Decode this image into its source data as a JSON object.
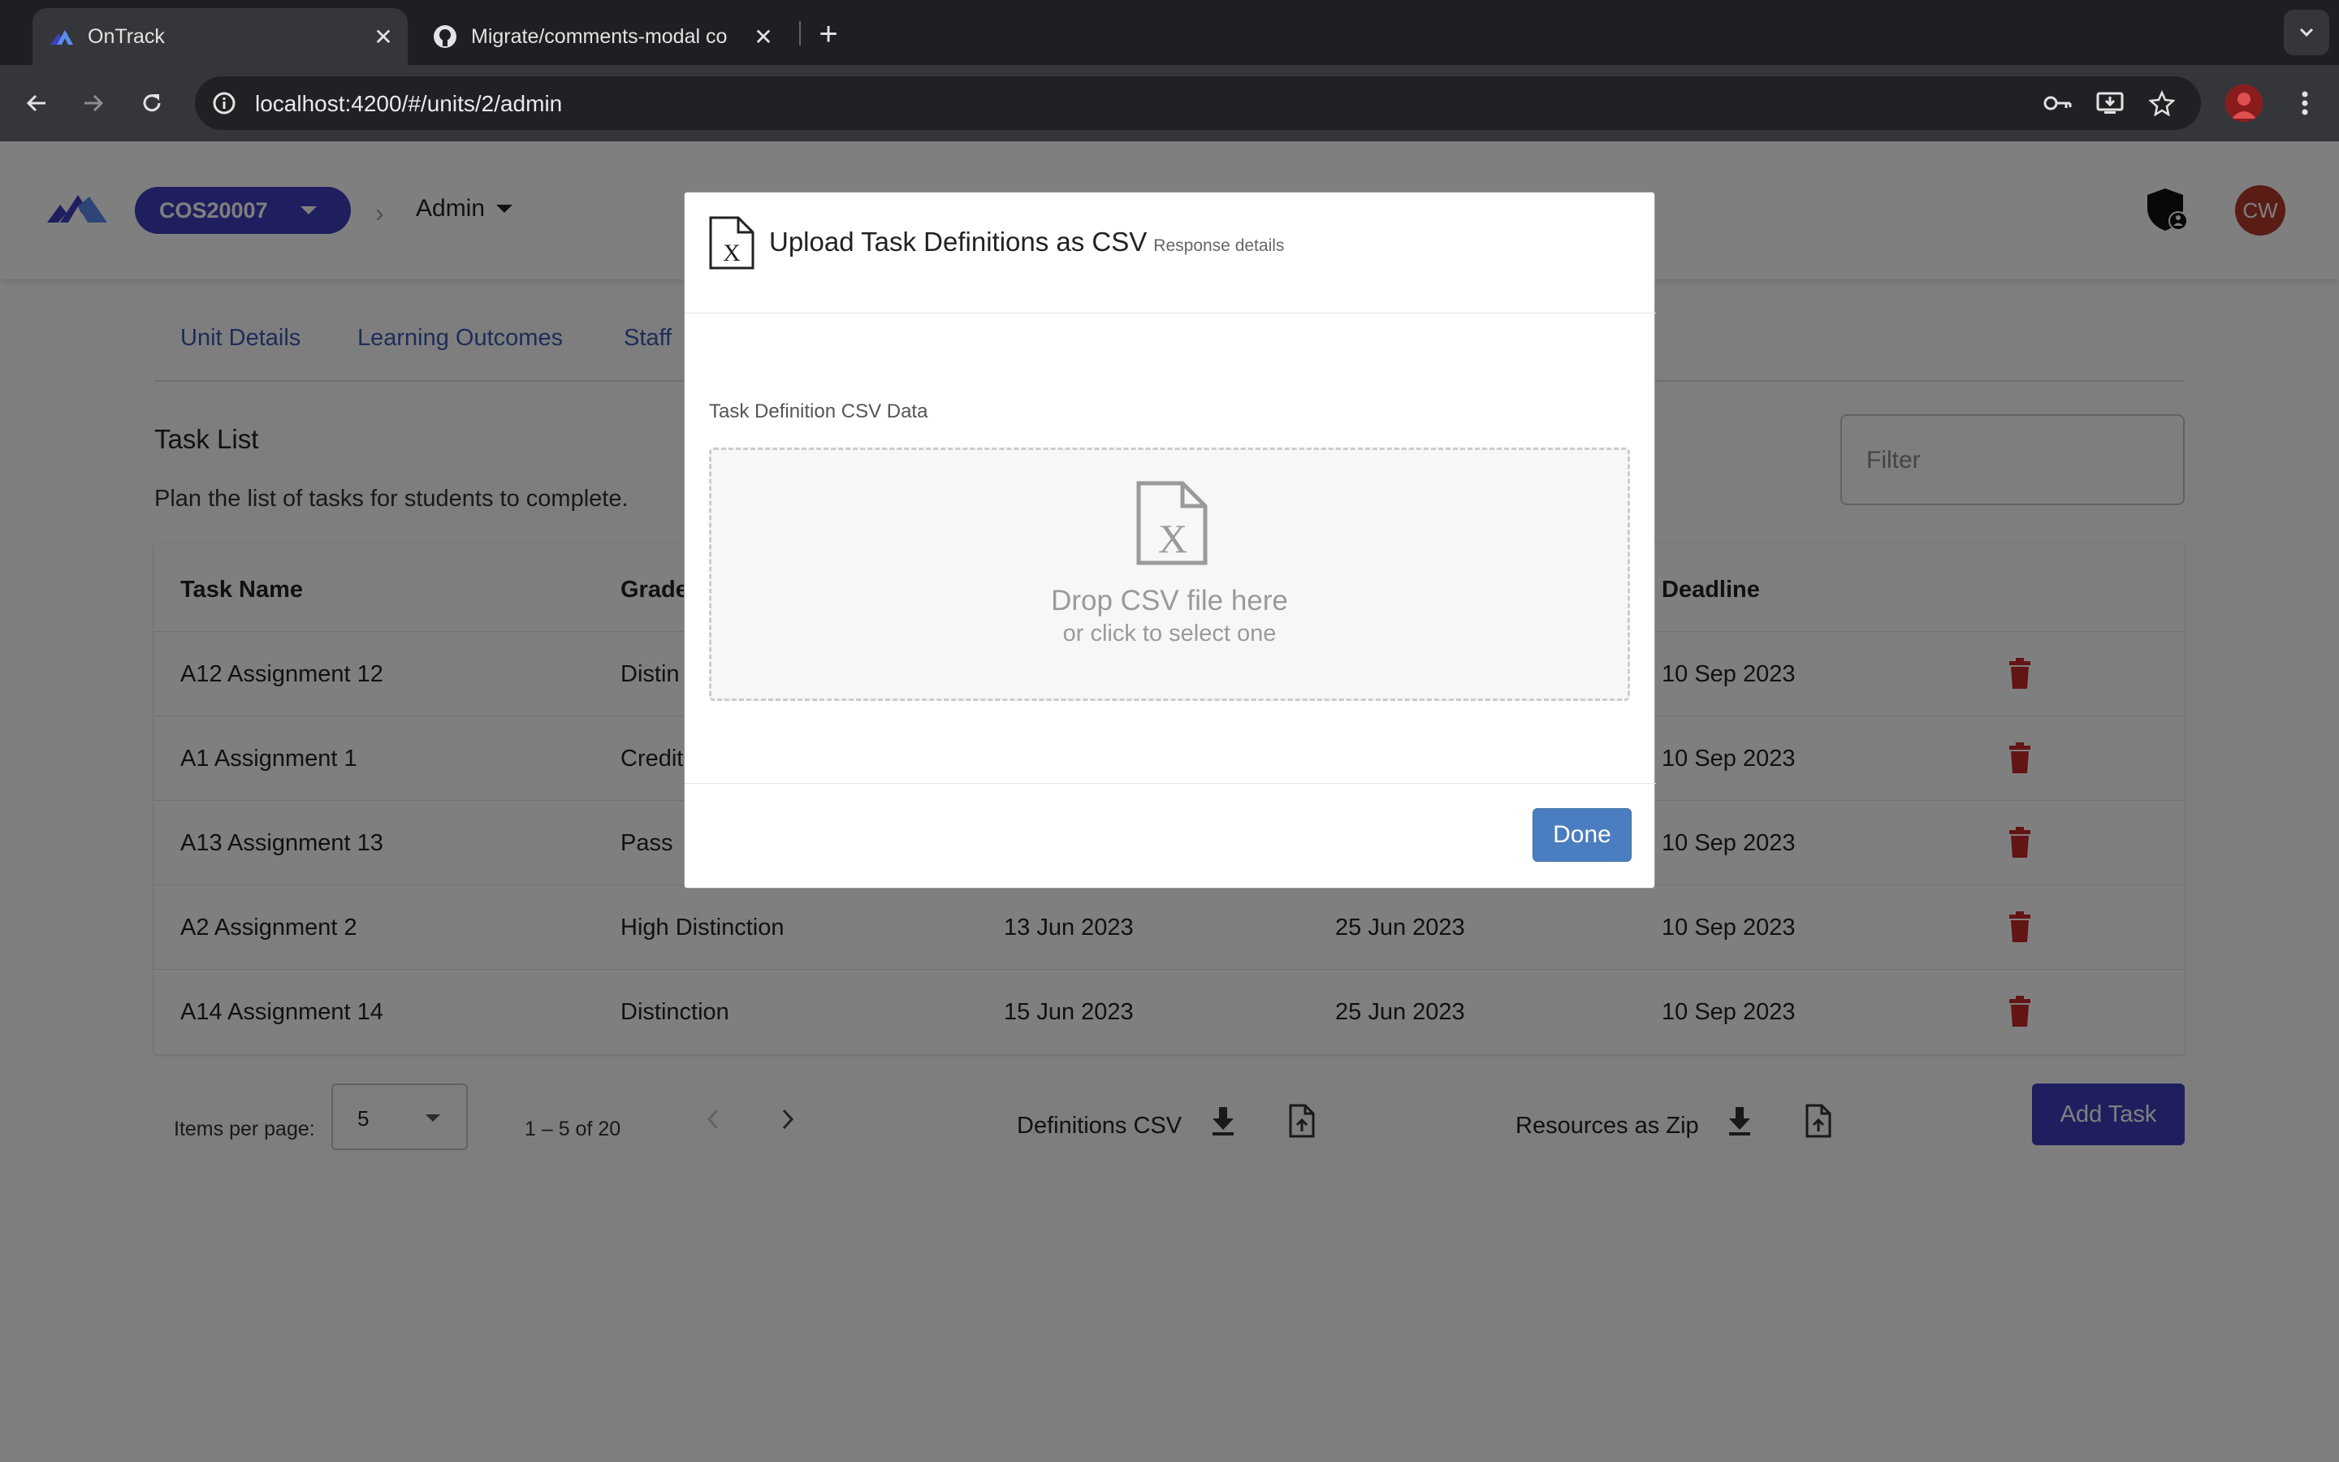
{
  "browser": {
    "tabs": [
      {
        "title": "OnTrack",
        "active": true
      },
      {
        "title": "Migrate/comments-modal co",
        "active": false
      }
    ],
    "url": "localhost:4200/#/units/2/admin"
  },
  "header": {
    "unit_code": "COS20007",
    "section": "Admin",
    "avatar_initials": "CW"
  },
  "nav_tabs": [
    "Unit Details",
    "Learning Outcomes",
    "Staff"
  ],
  "task_list": {
    "title": "Task List",
    "description": "Plan the list of tasks for students to complete.",
    "filter_placeholder": "Filter",
    "columns": {
      "name": "Task Name",
      "grade": "Grade",
      "deadline": "Deadline"
    },
    "rows": [
      {
        "name": "A12 Assignment 12",
        "grade": "Distin",
        "start": "",
        "target": "",
        "deadline": "10 Sep 2023"
      },
      {
        "name": "A1 Assignment 1",
        "grade": "Credit",
        "start": "",
        "target": "",
        "deadline": "10 Sep 2023"
      },
      {
        "name": "A13 Assignment 13",
        "grade": "Pass",
        "start": "",
        "target": "",
        "deadline": "10 Sep 2023"
      },
      {
        "name": "A2 Assignment 2",
        "grade": "High Distinction",
        "start": "13 Jun 2023",
        "target": "25 Jun 2023",
        "deadline": "10 Sep 2023"
      },
      {
        "name": "A14 Assignment 14",
        "grade": "Distinction",
        "start": "15 Jun 2023",
        "target": "25 Jun 2023",
        "deadline": "10 Sep 2023"
      }
    ]
  },
  "pagination": {
    "items_per_page_label": "Items per page:",
    "items_per_page_value": "5",
    "range": "1 – 5 of 20"
  },
  "actions": {
    "definitions_label": "Definitions CSV",
    "resources_label": "Resources as Zip",
    "add_task_label": "Add Task"
  },
  "modal": {
    "title": "Upload Task Definitions as CSV",
    "subtitle": "Response details",
    "field_label": "Task Definition CSV Data",
    "drop_main": "Drop CSV file here",
    "drop_minor": "or click to select one",
    "done_label": "Done"
  },
  "colors": {
    "primary": "#3f3fbf",
    "link": "#3b5ab0",
    "delete": "#c62828",
    "done_button": "#4a7ec0"
  }
}
